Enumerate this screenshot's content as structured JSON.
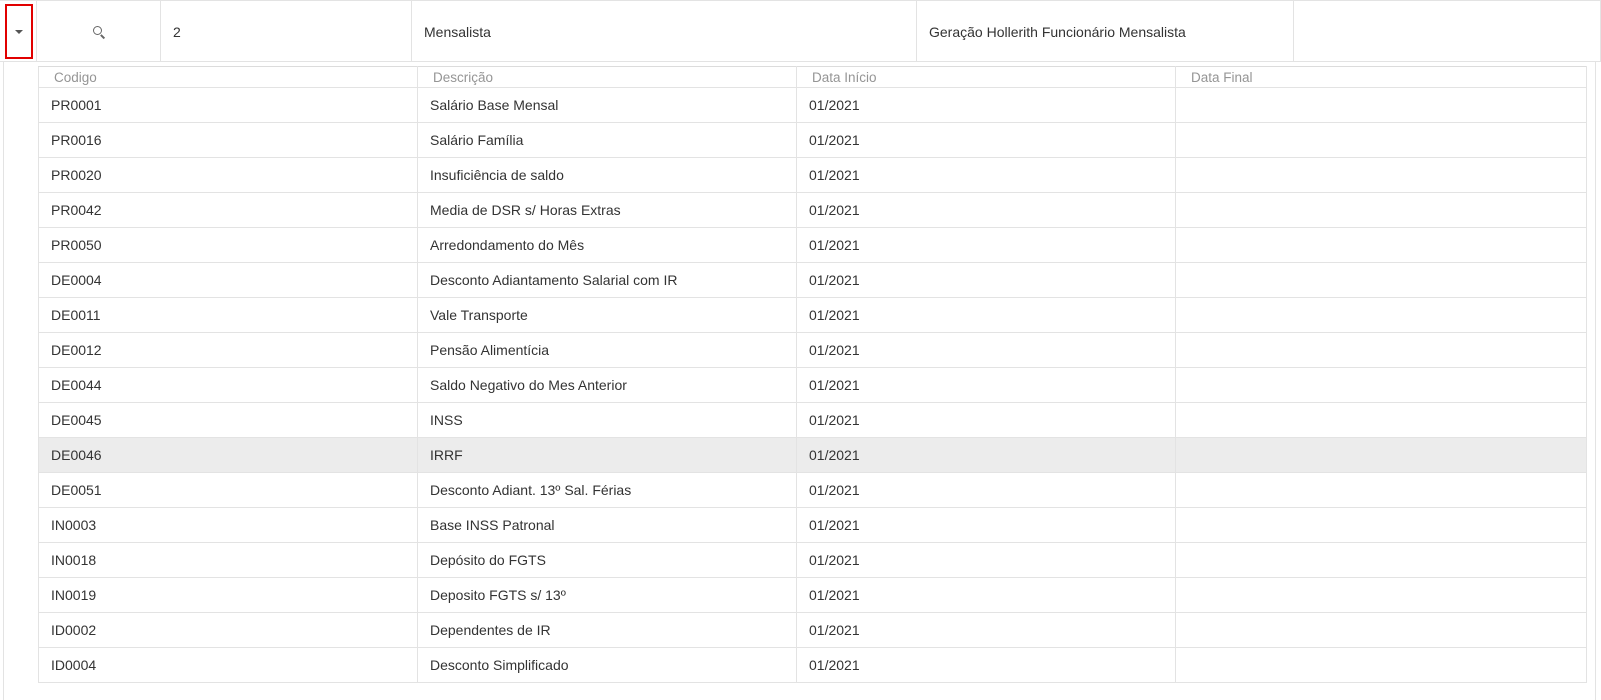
{
  "parent_row": {
    "number": "2",
    "type": "Mensalista",
    "description": "Geração Hollerith Funcionário Mensalista",
    "icons": {
      "expand": "caret-down-icon",
      "search": "search-icon"
    }
  },
  "detail": {
    "columns": [
      "Codigo",
      "Descrição",
      "Data Início",
      "Data Final"
    ],
    "rows": [
      {
        "codigo": "PR0001",
        "descricao": "Salário Base Mensal",
        "data_inicio": "01/2021",
        "data_final": ""
      },
      {
        "codigo": "PR0016",
        "descricao": "Salário Família",
        "data_inicio": "01/2021",
        "data_final": ""
      },
      {
        "codigo": "PR0020",
        "descricao": "Insuficiência de saldo",
        "data_inicio": "01/2021",
        "data_final": ""
      },
      {
        "codigo": "PR0042",
        "descricao": "Media de DSR s/ Horas Extras",
        "data_inicio": "01/2021",
        "data_final": ""
      },
      {
        "codigo": "PR0050",
        "descricao": "Arredondamento do Mês",
        "data_inicio": "01/2021",
        "data_final": ""
      },
      {
        "codigo": "DE0004",
        "descricao": "Desconto Adiantamento Salarial com IR",
        "data_inicio": "01/2021",
        "data_final": ""
      },
      {
        "codigo": "DE0011",
        "descricao": "Vale Transporte",
        "data_inicio": "01/2021",
        "data_final": ""
      },
      {
        "codigo": "DE0012",
        "descricao": "Pensão Alimentícia",
        "data_inicio": "01/2021",
        "data_final": ""
      },
      {
        "codigo": "DE0044",
        "descricao": "Saldo Negativo do Mes Anterior",
        "data_inicio": "01/2021",
        "data_final": ""
      },
      {
        "codigo": "DE0045",
        "descricao": "INSS",
        "data_inicio": "01/2021",
        "data_final": ""
      },
      {
        "codigo": "DE0046",
        "descricao": "IRRF",
        "data_inicio": "01/2021",
        "data_final": "",
        "selected": true
      },
      {
        "codigo": "DE0051",
        "descricao": "Desconto Adiant. 13º Sal. Férias",
        "data_inicio": "01/2021",
        "data_final": ""
      },
      {
        "codigo": "IN0003",
        "descricao": "Base INSS Patronal",
        "data_inicio": "01/2021",
        "data_final": ""
      },
      {
        "codigo": "IN0018",
        "descricao": "Depósito do FGTS",
        "data_inicio": "01/2021",
        "data_final": ""
      },
      {
        "codigo": "IN0019",
        "descricao": "Deposito FGTS s/ 13º",
        "data_inicio": "01/2021",
        "data_final": ""
      },
      {
        "codigo": "ID0002",
        "descricao": "Dependentes de IR",
        "data_inicio": "01/2021",
        "data_final": ""
      },
      {
        "codigo": "ID0004",
        "descricao": "Desconto Simplificado",
        "data_inicio": "01/2021",
        "data_final": ""
      }
    ]
  },
  "colors": {
    "expand_highlight": "#e10000",
    "selected_row": "#ececec",
    "border": "#e3e3e3",
    "header_text": "#959595"
  }
}
